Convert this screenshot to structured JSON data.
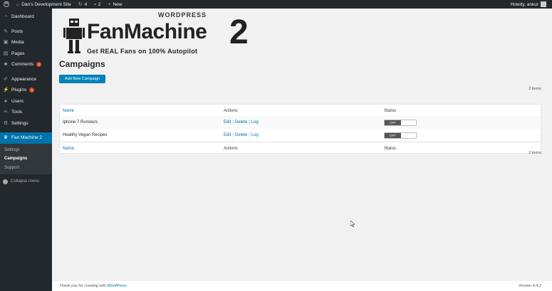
{
  "adminbar": {
    "site": "Dan's Development Site",
    "updates": "4",
    "comments": "2",
    "new": "New",
    "howdy": "Howdy, ankur"
  },
  "sidebar": {
    "items": [
      {
        "label": "Dashboard",
        "icon": "dashboard-icon"
      },
      {
        "label": "Posts",
        "icon": "pin-icon"
      },
      {
        "label": "Media",
        "icon": "media-icon"
      },
      {
        "label": "Pages",
        "icon": "pages-icon"
      },
      {
        "label": "Comments",
        "icon": "comments-icon",
        "badge": "2"
      },
      {
        "label": "Appearance",
        "icon": "brush-icon"
      },
      {
        "label": "Plugins",
        "icon": "plugin-icon",
        "badge": "1"
      },
      {
        "label": "Users",
        "icon": "users-icon"
      },
      {
        "label": "Tools",
        "icon": "wrench-icon"
      },
      {
        "label": "Settings",
        "icon": "settings-icon"
      },
      {
        "label": "Fan Machine 2",
        "icon": "fanmachine-icon"
      }
    ],
    "submenu": [
      "Settings",
      "Campaigns",
      "Support"
    ],
    "collapse": "Collapse menu"
  },
  "logo": {
    "wordpress": "WORDPRESS",
    "name": "FanMachine",
    "number": "2",
    "tagline": "Get REAL Fans on 100% Autopilot"
  },
  "page": {
    "title": "Campaigns",
    "add_button": "Add New Campaign",
    "count_top": "2 items",
    "count_bottom": "2 items"
  },
  "table": {
    "columns": [
      "Name",
      "Actions",
      "Status"
    ],
    "rows": [
      {
        "name": "Iphone 7 Rumours",
        "edit": "Edit",
        "delete": "Delete",
        "log": "Log",
        "status": "OFF"
      },
      {
        "name": "Healthy Vegan Recipes",
        "edit": "Edit",
        "delete": "Delete",
        "log": "Log",
        "status": "OFF"
      }
    ]
  },
  "footer": {
    "thanks": "Thank you for creating with",
    "wp_link": "WordPress.",
    "version": "Version 4.4.2"
  },
  "colors": {
    "accent": "#0073aa",
    "button": "#0085ba",
    "adminbar": "#23282d",
    "badge": "#d54e21"
  }
}
